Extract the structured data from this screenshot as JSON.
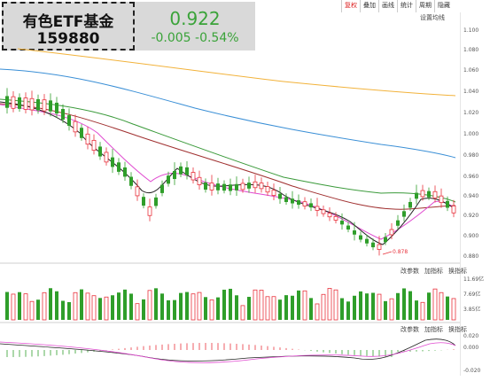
{
  "header": {
    "name": "有色ETF基金",
    "code": "159880",
    "price": "0.922",
    "change": "-0.005 -0.54%"
  },
  "toolbar": [
    "复权",
    "叠加",
    "画线",
    "统计",
    "周期",
    "隐藏"
  ],
  "settings_label": "设置均线",
  "price_axis": [
    "1.100",
    "1.080",
    "1.060",
    "1.040",
    "1.020",
    "1.000",
    "0.980",
    "0.960",
    "0.940",
    "0.920",
    "0.900",
    "0.880"
  ],
  "volume_axis": [
    "11.69亿",
    "7.69亿",
    "3.85亿"
  ],
  "macd_axis": [
    "0.020",
    "0.000",
    "-0.020"
  ],
  "low_label": "0.878",
  "volume_panel_buttons": [
    "改参数",
    "加指标",
    "换指标"
  ],
  "macd_panel_buttons": [
    "改参数",
    "加指标",
    "换指标"
  ],
  "colors": {
    "up": "#e8323c",
    "down": "#2f9e2a",
    "ma5": "#222222",
    "ma10": "#e04ad0",
    "ma20": "#3a9a3a",
    "ma30": "#a03030",
    "ma60": "#3a8fd6",
    "ma120": "#f2b23a"
  }
}
